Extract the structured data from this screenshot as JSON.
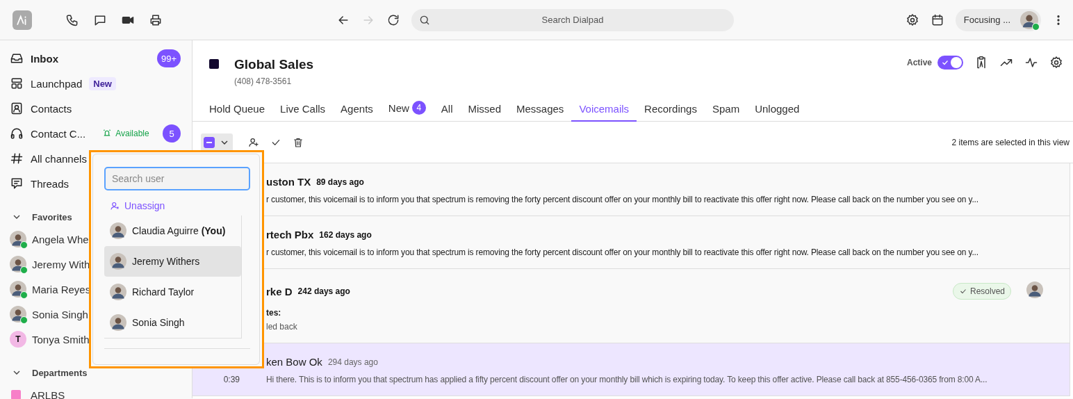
{
  "topbar": {
    "search": {
      "placeholder": "Search Dialpad"
    },
    "forward_disabled": true,
    "status": "Focusing ...",
    "online": true
  },
  "sidebar": {
    "nav": [
      {
        "label": "Inbox",
        "bold": true,
        "badge": "99+"
      },
      {
        "label": "Launchpad",
        "bold": false,
        "tag": "New"
      },
      {
        "label": "Contacts",
        "bold": false
      },
      {
        "label": "Contact C...",
        "bold": false,
        "availability": "Available",
        "badge": "5"
      },
      {
        "label": "All channels",
        "bold": false
      },
      {
        "label": "Threads",
        "bold": false
      }
    ],
    "favorites": {
      "title": "Favorites",
      "expanded": true,
      "items": [
        {
          "name": "Angela Whe",
          "online": true
        },
        {
          "name": "Jeremy With",
          "online": true
        },
        {
          "name": "Maria Reyes",
          "online": true
        },
        {
          "name": "Sonia Singh",
          "online": true
        },
        {
          "name": "Tonya Smith",
          "online": false,
          "initial": "T"
        }
      ]
    },
    "departments": {
      "title": "Departments",
      "expanded": true,
      "items": [
        {
          "name": "ARLBS",
          "color": "#f77fc8"
        }
      ]
    }
  },
  "header": {
    "title": "Global Sales",
    "phone": "(408) 478-3561",
    "status_label": "Active",
    "active": true
  },
  "tabs": [
    {
      "label": "Hold Queue",
      "selected": false
    },
    {
      "label": "Live Calls",
      "selected": false
    },
    {
      "label": "Agents",
      "selected": false
    },
    {
      "label": "New",
      "selected": false,
      "count": "4"
    },
    {
      "label": "All",
      "selected": false
    },
    {
      "label": "Missed",
      "selected": false
    },
    {
      "label": "Messages",
      "selected": false
    },
    {
      "label": "Voicemails",
      "selected": true
    },
    {
      "label": "Recordings",
      "selected": false
    },
    {
      "label": "Spam",
      "selected": false
    },
    {
      "label": "Unlogged",
      "selected": false
    }
  ],
  "toolbar": {
    "indeterminate": true,
    "selection_text": "2 items are selected in this view"
  },
  "voicemails": [
    {
      "title": "uston TX",
      "age": "89 days ago",
      "unread": true,
      "selected": false,
      "text": "r customer, this voicemail is to inform you that spectrum is removing the forty percent discount offer on your monthly bill to reactivate this offer right now. Please call back on the number you see on y..."
    },
    {
      "title": "rtech Pbx",
      "age": "162 days ago",
      "unread": true,
      "selected": false,
      "text": "r customer, this voicemail is to inform you that spectrum is removing the forty percent discount offer on your monthly bill to reactivate this offer right now. Please call back on the number you see on y..."
    },
    {
      "title": "rke D",
      "age": "242 days ago",
      "unread": true,
      "selected": false,
      "notes_label": "tes:",
      "note": "led back",
      "status": "Resolved",
      "assignee": true
    },
    {
      "title": "ken Bow Ok",
      "age": "294 days ago",
      "unread": false,
      "selected": true,
      "duration": "0:39",
      "text": "Hi there. This is to inform you that spectrum has applied a fifty percent discount offer on your monthly bill which is expiring today. To keep this offer active. Please call back at 855-456-0365 from 8:00 A..."
    }
  ],
  "assign_menu": {
    "search": {
      "placeholder": "Search user"
    },
    "unassign": "Unassign",
    "users": [
      {
        "name": "Claudia Aguirre **(You)**",
        "selected": false
      },
      {
        "name": "Jeremy Withers",
        "selected": true
      },
      {
        "name": "Richard Taylor",
        "selected": false
      },
      {
        "name": "Sonia Singh",
        "selected": false
      }
    ]
  }
}
